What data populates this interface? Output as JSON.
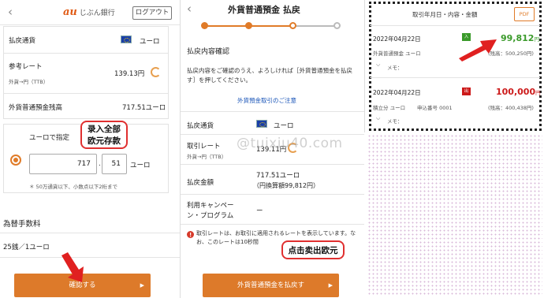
{
  "panel1": {
    "logo_mark": "au",
    "logo_text": "じぶん銀行",
    "logout_label": "ログアウト",
    "currency_label": "払戻通貨",
    "currency_value": "ユーロ",
    "rate_label": "参考レート",
    "rate_sub": "外貨→円（TTB）",
    "rate_value": "139.13円",
    "balance_label": "外貨普通預金残高",
    "balance_value": "717.51ユーロ",
    "specify_label": "ユーロで指定",
    "amount_int": "717",
    "amount_dec": "51",
    "amount_unit": "ユーロ",
    "amount_note": "50万通貨以下、小数点以下2桁まで",
    "callout_line1": "录入全部",
    "callout_line2": "欧元存款",
    "fee_title": "為替手数料",
    "fee_value": "25銭／1ユーロ",
    "confirm_button": "確認する"
  },
  "panel2": {
    "title": "外貨普通預金 払戻",
    "section_title": "払戻内容確認",
    "intro": "払戻内容をご確認のうえ、よろしければ［外貨普通預金を払戻す］を押してください。",
    "notice_link": "外貨預金取引のご注意",
    "currency_label": "払戻通貨",
    "currency_value": "ユーロ",
    "rate_label": "取引レート",
    "rate_sub": "外貨→円（TTB）",
    "rate_value": "139.11円",
    "amount_label": "払戻金額",
    "amount_value": "717.51ユーロ",
    "amount_yen": "（円換算額99,812円）",
    "campaign_label": "利用キャンペーン・プログラム",
    "campaign_value": "ー",
    "footnote": "取引レートは、お取引に適用されるレートを表示しています。なお、このレートは10秒間",
    "callout": "点击卖出欧元",
    "submit_button": "外貨普通預金を払戻す"
  },
  "panel3": {
    "header": "取引年月日・内容・金額",
    "pdf_label": "PDF",
    "tx1": {
      "date": "2022年04月22日",
      "badge": "入",
      "amount": "99,812",
      "yen": "円",
      "desc": "外貨普通預金 ユーロ",
      "balance": "(残高：500,250円)",
      "memo": "メモ："
    },
    "tx2": {
      "date": "2022年04月22日",
      "badge": "出",
      "amount": "100,000",
      "yen": "円",
      "desc": "積立分 ユーロ",
      "ref": "申込番号 0001",
      "balance": "(残高：400,438円)",
      "memo": "メモ："
    }
  },
  "watermark": "@tuixiu40.com",
  "colors": {
    "accent": "#dd7a2a",
    "deposit_green": "#3a9a2a",
    "withdraw_red": "#cc1a1a",
    "link_blue": "#1a55b8",
    "arrow_red": "#e02020"
  }
}
